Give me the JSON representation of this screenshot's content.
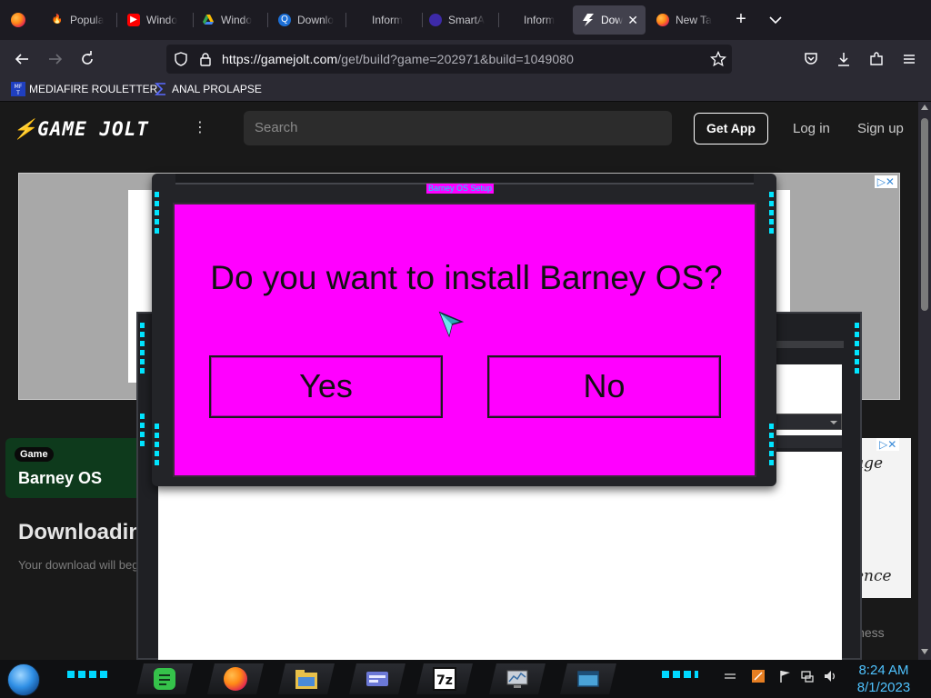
{
  "browser": {
    "tabs": [
      {
        "label": "Popula",
        "icon": "fire-icon",
        "color": "#e8562a"
      },
      {
        "label": "Windo",
        "icon": "youtube-icon",
        "color": "#ff0000"
      },
      {
        "label": "Windo",
        "icon": "drive-icon",
        "color": "#34a853"
      },
      {
        "label": "Downlo",
        "icon": "q-icon",
        "color": "#1c6fd6"
      },
      {
        "label": "Inform",
        "icon": "blank-icon",
        "color": ""
      },
      {
        "label": "SmartA",
        "icon": "circle-icon",
        "color": "#3d2aa8"
      },
      {
        "label": "Inform",
        "icon": "blank-icon",
        "color": ""
      },
      {
        "label": "Dow",
        "icon": "gamejolt-icon",
        "color": "#ffffff",
        "active": true
      },
      {
        "label": "New Ta",
        "icon": "firefox-icon",
        "color": "#ff7a16"
      }
    ],
    "url_host": "https://gamejolt.com",
    "url_path": "/get/build?game=202971&build=1049080",
    "bookmarks": [
      {
        "label": "MEDIAFIRE ROULETTER",
        "icon": "mediafire-icon"
      },
      {
        "label": "ANAL PROLAPSE",
        "icon": "sigma-icon"
      }
    ]
  },
  "site": {
    "logo_text": "GAME JOLT",
    "search_placeholder": "Search",
    "get_app": "Get App",
    "login": "Log in",
    "signup": "Sign up",
    "game_pill": "Game",
    "game_name": "Barney OS",
    "downloading": "Downloading",
    "download_sub": "Your download will beg",
    "ad_text_1": "age",
    "ad_text_2": "ence",
    "ad_text_3": "iness"
  },
  "dialog": {
    "title": "Barney OS Setup",
    "question": "Do you want to install Barney OS?",
    "yes": "Yes",
    "no": "No",
    "bg_color": "#ff00ff",
    "accent": "#00e5ff"
  },
  "taskbar": {
    "time": "8:24 AM",
    "date": "8/1/2023",
    "apps": [
      "notes-icon",
      "firefox-icon",
      "file-manager-icon",
      "7zip-icon",
      "card-icon",
      "monitor-icon",
      "window-icon"
    ]
  }
}
